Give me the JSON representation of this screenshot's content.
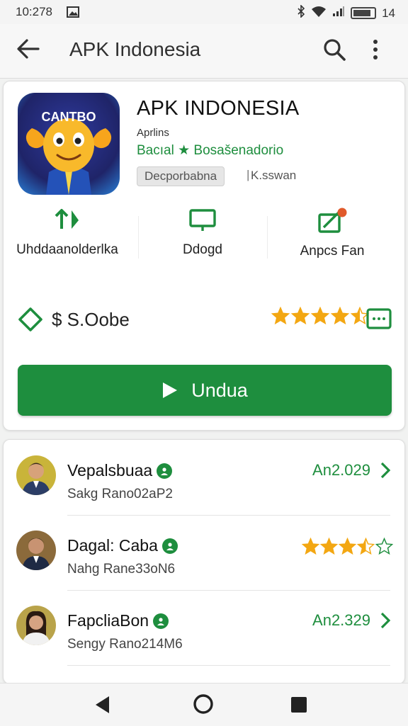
{
  "status": {
    "time": "10:278",
    "battery": "14"
  },
  "appbar": {
    "title": "APK Indonesia"
  },
  "app": {
    "name": "APK INDONESIA",
    "icon_text": "CANTBO",
    "developer": "Aprlins",
    "category": "Bacıal ★ Bosašenadorio",
    "tag": "Decporbabna",
    "tag_separator": "|",
    "tag_extra": "K.sswan"
  },
  "stats": [
    {
      "icon": "transfer-icon",
      "label": "Uhddaanolderlka"
    },
    {
      "icon": "screen-icon",
      "label": "Ddogd"
    },
    {
      "icon": "share-icon",
      "label": "Anpcs Fan"
    }
  ],
  "price": {
    "text": "$ S.Oobe"
  },
  "rating": {
    "value": 4.5,
    "max": 5
  },
  "install": {
    "label": "Undua"
  },
  "reviews": [
    {
      "name": "Vepalsbuaa",
      "sub": "Sakg Rano02aP2",
      "right_text": "An2.029"
    },
    {
      "name": "Dagal: Caba",
      "sub": "Nahg Rane33oN6",
      "rating": 3.5,
      "max": 5
    },
    {
      "name": "FapcliaBon",
      "sub": "Sengy Rano214M6",
      "right_text": "An2.329"
    }
  ],
  "colors": {
    "accent": "#1e8e3e",
    "star": "#f3a712"
  }
}
